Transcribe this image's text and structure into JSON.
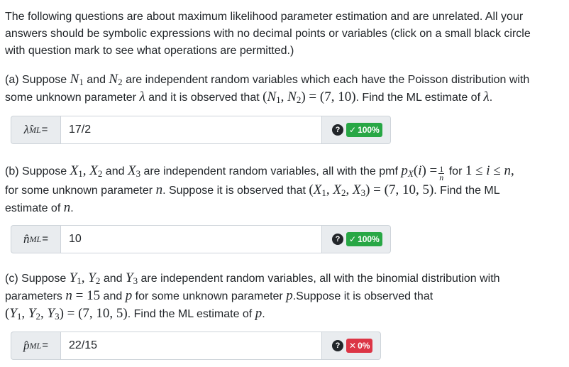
{
  "intro": {
    "line1": "The following questions are about maximum likelihood parameter estimation and are unrelated. All your",
    "line2": "answers should be symbolic expressions with no decimal points or variables (click on a small black circle",
    "line3": "with question mark to see what operations are permitted.)"
  },
  "part_a": {
    "prefix": "(a) Suppose",
    "and": "and",
    "text1": "are independent random variables which each have the Poisson distribution with",
    "text2": "some unknown parameter",
    "text3": "and it is observed that",
    "text4": ". Find the ML estimate of",
    "observed": "(N₁, N₂) = (7, 10)",
    "answer_label": "λ̂",
    "answer_value": "17/2",
    "grade": "100%",
    "grade_icon": "check-icon"
  },
  "part_b": {
    "prefix": "(b) Suppose",
    "and": "and",
    "text1": "are independent random variables, all with the pmf",
    "text_for": "for",
    "text2": "for some unknown parameter",
    "text3": ". Suppose it is observed that",
    "text4": ". Find the ML",
    "text5": "estimate of",
    "observed": "(X₁, X₂, X₃) = (7, 10, 5)",
    "answer_label": "n̂",
    "answer_value": "10",
    "grade": "100%",
    "grade_icon": "check-icon"
  },
  "part_c": {
    "prefix": "(c) Suppose",
    "and": "and",
    "text1": "are independent random variables, all with the binomial distribution with",
    "text2": "parameters",
    "text3": "and",
    "text4": "for some unknown parameter",
    "text5": ".Suppose it is observed that",
    "text6": ". Find the ML estimate of",
    "observed": "(Y₁, Y₂, Y₃) = (7, 10, 5)",
    "answer_label": "p̂",
    "answer_value": "22/15",
    "grade": "0%",
    "grade_icon": "x-icon"
  },
  "common": {
    "ml_sub": "ML",
    "equals": "=",
    "help_glyph": "?"
  },
  "colors": {
    "correct": "#28a745",
    "incorrect": "#dc3545",
    "addon_bg": "#e9ecef",
    "border": "#ced4da"
  }
}
